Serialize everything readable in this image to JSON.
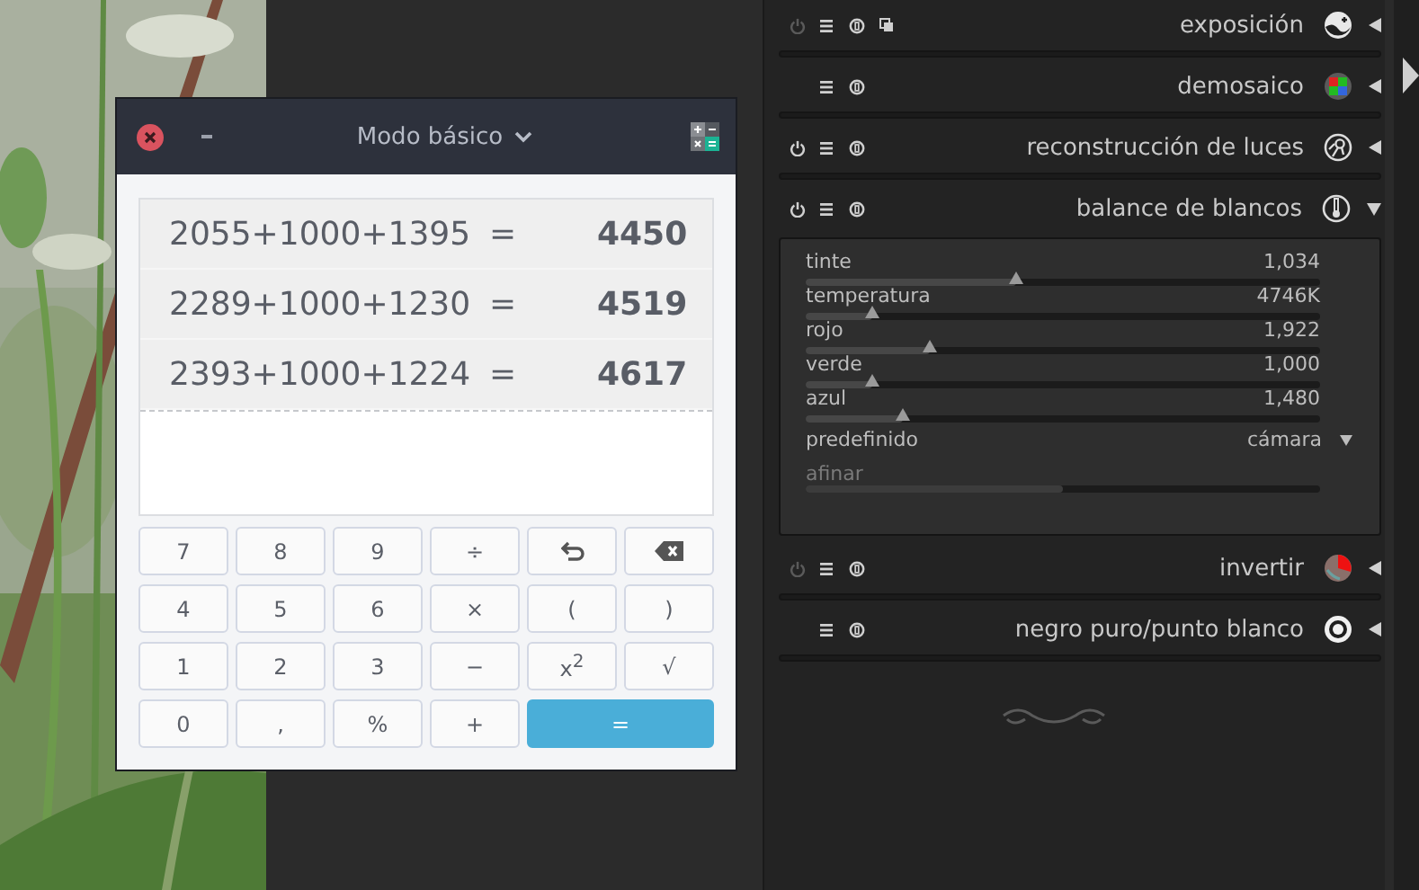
{
  "calculator": {
    "title": "Modo básico",
    "history": [
      {
        "expression": "2055+1000+1395",
        "equals": "=",
        "result": "4450"
      },
      {
        "expression": "2289+1000+1230",
        "equals": "=",
        "result": "4519"
      },
      {
        "expression": "2393+1000+1224",
        "equals": "=",
        "result": "4617"
      }
    ],
    "keys": [
      {
        "kind": "key",
        "label": "7"
      },
      {
        "kind": "key",
        "label": "8"
      },
      {
        "kind": "key",
        "label": "9"
      },
      {
        "kind": "key",
        "label": "÷"
      },
      {
        "kind": "undo"
      },
      {
        "kind": "backspace"
      },
      {
        "kind": "key",
        "label": "4"
      },
      {
        "kind": "key",
        "label": "5"
      },
      {
        "kind": "key",
        "label": "6"
      },
      {
        "kind": "key",
        "label": "×"
      },
      {
        "kind": "key",
        "label": "("
      },
      {
        "kind": "key",
        "label": ")"
      },
      {
        "kind": "key",
        "label": "1"
      },
      {
        "kind": "key",
        "label": "2"
      },
      {
        "kind": "key",
        "label": "3"
      },
      {
        "kind": "key",
        "label": "−"
      },
      {
        "kind": "key",
        "label": "x$^{2}$"
      },
      {
        "kind": "key",
        "label": "√"
      },
      {
        "kind": "key",
        "label": "0"
      },
      {
        "kind": "key",
        "label": ","
      },
      {
        "kind": "key",
        "label": "%"
      },
      {
        "kind": "key",
        "label": "+"
      },
      {
        "kind": "equals",
        "label": "="
      }
    ]
  },
  "modules": [
    {
      "title": "exposición",
      "kind": "switchable",
      "enabled": false,
      "multi_instance": true,
      "expanded": false
    },
    {
      "title": "demosaico",
      "kind": "fixed",
      "multi_instance": false,
      "expanded": false
    },
    {
      "title": "reconstrucción de luces",
      "kind": "switchable",
      "enabled": true,
      "multi_instance": false,
      "expanded": false
    },
    {
      "title": "balance de blancos",
      "kind": "switchable",
      "enabled": true,
      "multi_instance": false,
      "expanded": true,
      "controls": [
        {
          "kind": "slider",
          "label": "tinte",
          "value": "1,034",
          "level": 0.41
        },
        {
          "kind": "slider",
          "label": "temperatura",
          "value": "4746K",
          "level": 0.13
        },
        {
          "kind": "slider",
          "label": "rojo",
          "value": "1,922",
          "level": 0.24
        },
        {
          "kind": "slider",
          "label": "verde",
          "value": "1,000",
          "level": 0.13
        },
        {
          "kind": "slider",
          "label": "azul",
          "value": "1,480",
          "level": 0.19
        },
        {
          "kind": "dropdown",
          "label": "predefinido",
          "value": "cámara"
        },
        {
          "kind": "bar",
          "label": "afinar",
          "level": 0.5
        }
      ]
    },
    {
      "title": "invertir",
      "kind": "switchable",
      "enabled": false,
      "multi_instance": false,
      "expanded": false
    },
    {
      "title": "negro puro/punto blanco",
      "kind": "fixed",
      "multi_instance": false,
      "expanded": false
    }
  ]
}
